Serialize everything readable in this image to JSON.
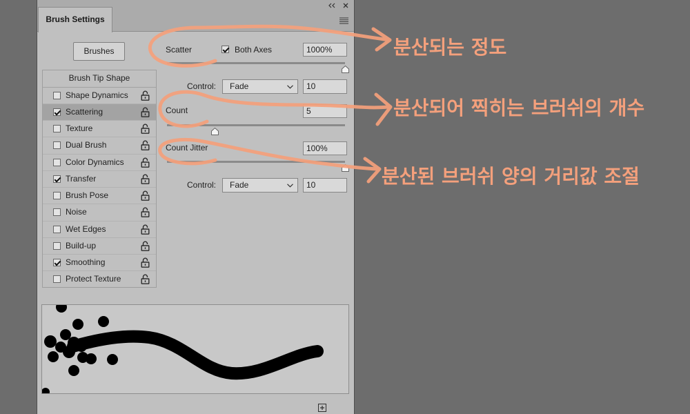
{
  "panel": {
    "collapse_icon": "double-chevron-left-icon",
    "close_icon": "close-icon",
    "menu_icon": "panel-menu-icon",
    "tab_label": "Brush Settings",
    "brushes_button": "Brushes",
    "new_preset_icon": "new-preset-icon"
  },
  "sidebar": {
    "header": "Brush Tip Shape",
    "lock_icon": "unlock-icon",
    "items": [
      {
        "label": "Shape Dynamics",
        "checked": false,
        "selected": false
      },
      {
        "label": "Scattering",
        "checked": true,
        "selected": true
      },
      {
        "label": "Texture",
        "checked": false,
        "selected": false
      },
      {
        "label": "Dual Brush",
        "checked": false,
        "selected": false
      },
      {
        "label": "Color Dynamics",
        "checked": false,
        "selected": false
      },
      {
        "label": "Transfer",
        "checked": true,
        "selected": false
      },
      {
        "label": "Brush Pose",
        "checked": false,
        "selected": false
      },
      {
        "label": "Noise",
        "checked": false,
        "selected": false
      },
      {
        "label": "Wet Edges",
        "checked": false,
        "selected": false
      },
      {
        "label": "Build-up",
        "checked": false,
        "selected": false
      },
      {
        "label": "Smoothing",
        "checked": true,
        "selected": false
      },
      {
        "label": "Protect Texture",
        "checked": false,
        "selected": false
      }
    ]
  },
  "scatter": {
    "label": "Scatter",
    "both_axes": {
      "label": "Both Axes",
      "checked": true
    },
    "value": "1000%",
    "slider_fraction": 1.0
  },
  "scatter_control": {
    "label": "Control:",
    "selected": "Fade",
    "value": "10",
    "dropdown_icon": "chevron-down-icon"
  },
  "count": {
    "label": "Count",
    "value": "5",
    "slider_fraction": 0.27
  },
  "count_jitter": {
    "label": "Count Jitter",
    "value": "100%",
    "slider_fraction": 1.0
  },
  "count_jitter_control": {
    "label": "Control:",
    "selected": "Fade",
    "value": "10",
    "dropdown_icon": "chevron-down-icon"
  },
  "annotations": [
    {
      "text": "분산되는 정도"
    },
    {
      "text": "분산되어 찍히는 브러쉬의 개수"
    },
    {
      "text": "분산된 브러쉬 양의 거리값 조절"
    }
  ],
  "colors": {
    "annotation": "#f4a07c",
    "background": "#6d6d6d",
    "panel": "#c0c0c0",
    "selected_row": "#a3a3a3"
  }
}
